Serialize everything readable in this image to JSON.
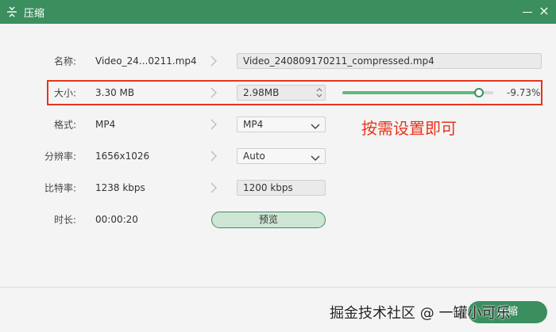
{
  "window": {
    "title": "压缩",
    "minimize_label": "",
    "close_label": "×"
  },
  "fields": {
    "name": {
      "label": "名称:",
      "original": "Video_24...0211.mp4",
      "output": "Video_240809170211_compressed.mp4"
    },
    "size": {
      "label": "大小:",
      "original": "3.30 MB",
      "output": "2.98MB",
      "percent_text": "-9.73%",
      "slider_fraction": 0.9027
    },
    "format": {
      "label": "格式:",
      "original": "MP4",
      "selected": "MP4"
    },
    "resolution": {
      "label": "分辨率:",
      "original": "1656x1026",
      "selected": "Auto"
    },
    "bitrate": {
      "label": "比特率:",
      "original": "1238 kbps",
      "output": "1200 kbps"
    },
    "duration": {
      "label": "时长:",
      "original": "00:00:20"
    }
  },
  "buttons": {
    "preview": "预览",
    "save": "压缩"
  },
  "annotation": "按需设置即可",
  "watermark": "掘金技术社区 @ 一罐小可乐",
  "colors": {
    "accent": "#3b8f5f",
    "highlight": "#e8341c",
    "slider_fill": "#5dbb7d"
  },
  "icons": {
    "title_icon": "compress-icon",
    "chevron": "chevron-right-icon"
  }
}
